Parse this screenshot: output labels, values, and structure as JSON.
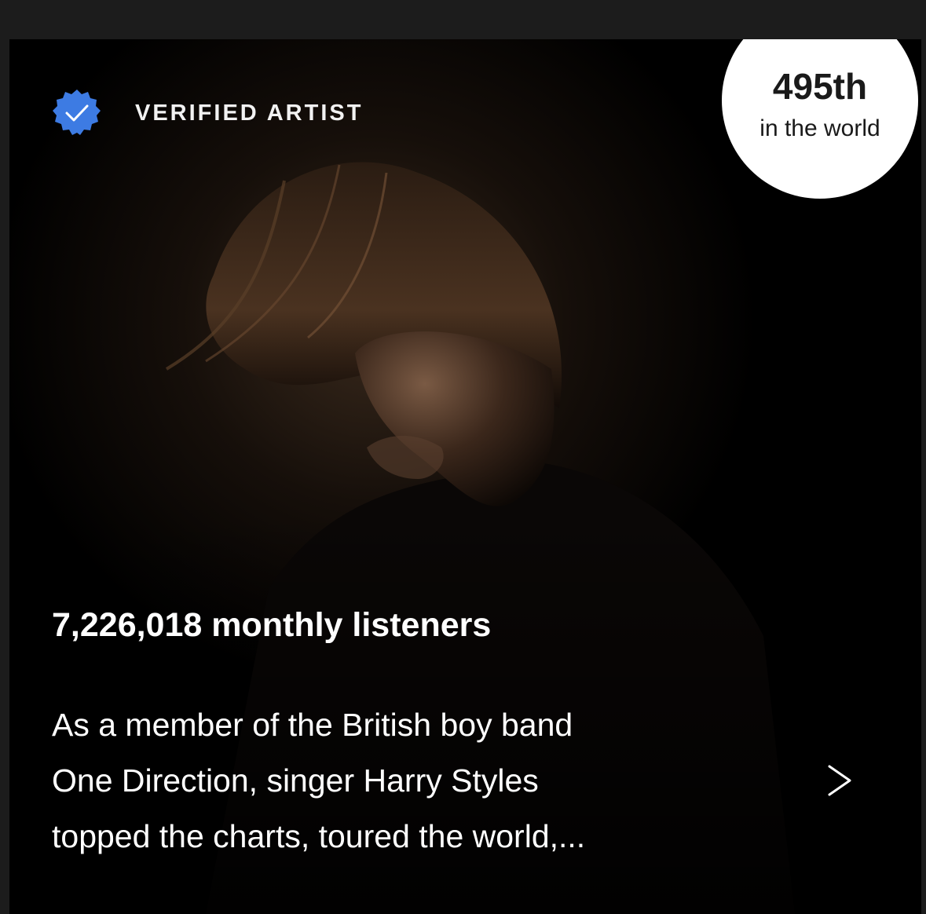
{
  "verified": {
    "label": "VERIFIED ARTIST",
    "badge_icon": "verified-check-badge-icon",
    "badge_color": "#3d7be3"
  },
  "rank": {
    "position": "495th",
    "scope": "in the world"
  },
  "stats": {
    "monthly_listeners": "7,226,018 monthly listeners"
  },
  "bio": {
    "lines": [
      "As a member of the British boy band",
      "One Direction, singer Harry Styles",
      "topped the charts, toured the world,..."
    ],
    "expand_icon": "chevron-right-icon"
  }
}
